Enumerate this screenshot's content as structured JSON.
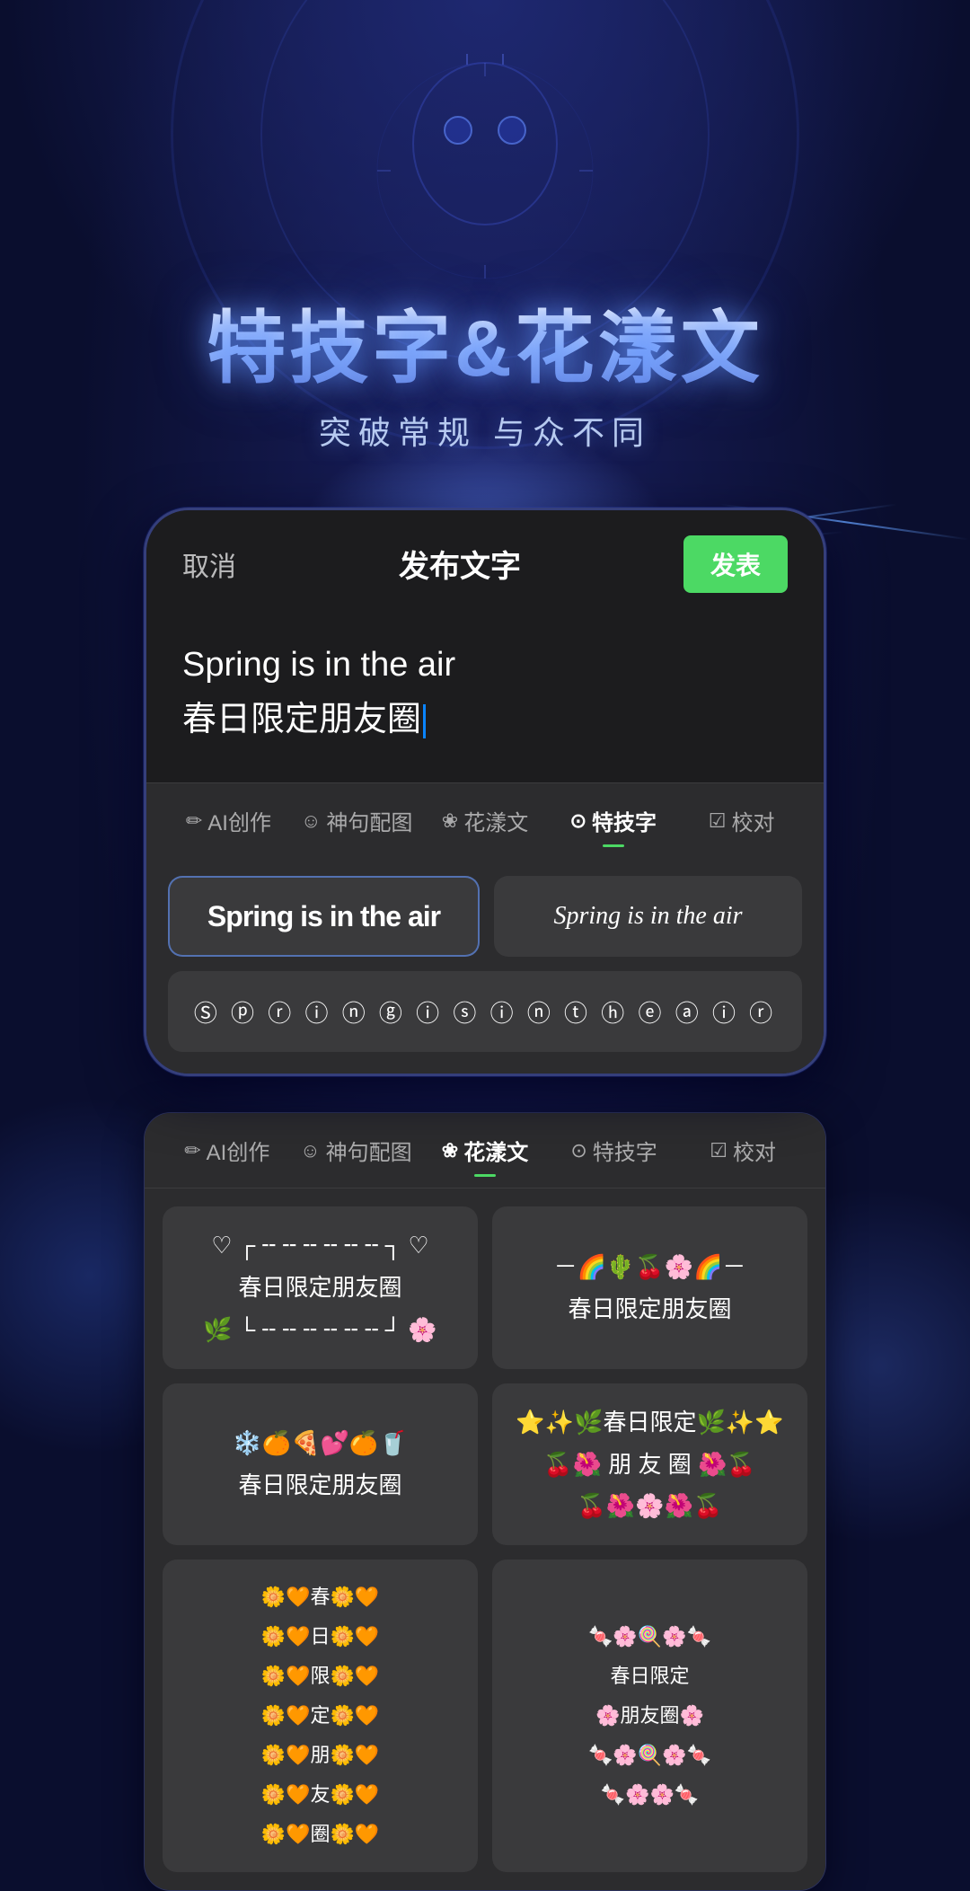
{
  "app": {
    "title": "特技字&花漾文",
    "subtitle": "突破常规 与众不同"
  },
  "editor": {
    "cancel_label": "取消",
    "title": "发布文字",
    "publish_label": "发表",
    "text_line1": "Spring is in the air",
    "text_line2": "春日限定朋友圈"
  },
  "toolbar1": {
    "tabs": [
      {
        "icon": "✏️",
        "label": "AI创作",
        "active": false
      },
      {
        "icon": "😊",
        "label": "神句配图",
        "active": false
      },
      {
        "icon": "✿",
        "label": "花漾文",
        "active": false
      },
      {
        "icon": "⊙",
        "label": "特技字",
        "active": true
      },
      {
        "icon": "☑",
        "label": "校对",
        "active": false
      }
    ]
  },
  "styles": {
    "option1": "Spring is in the air",
    "option2": "Spring is in the air",
    "option3": "Ⓢ ⓟ ⓡ ⓘ ⓝ ⓖ  ⓘ ⓢ  ⓘ ⓝ  ⓣ ⓗ ⓔ  ⓐ ⓘ ⓡ"
  },
  "toolbar2": {
    "tabs": [
      {
        "icon": "✏️",
        "label": "AI创作",
        "active": false
      },
      {
        "icon": "😊",
        "label": "神句配图",
        "active": false
      },
      {
        "icon": "✿",
        "label": "花漾文",
        "active": true
      },
      {
        "icon": "⊙",
        "label": "特技字",
        "active": false
      },
      {
        "icon": "☑",
        "label": "校对",
        "active": false
      }
    ]
  },
  "huawen_cards": [
    {
      "id": "hw1",
      "content": "♡ ┌╌╌╌╌╌╌╌╌╌╌╌┐ ♡\n春日限定朋友圈\n🌿 └╌╌╌╌╌╌╌╌╌╌╌┘ 🌸"
    },
    {
      "id": "hw2",
      "content": "－🌈🌵🌸🌈－\n春日限定朋友圈"
    },
    {
      "id": "hw3",
      "content": "❄️🍊🍕💕🍊🥤\n春日限定朋友圈"
    },
    {
      "id": "hw4",
      "content": "⭐✨🌿春日限定🌿✨⭐\n🍒🌺🌸朋友圈🌸🌺🍒\n🍒🌺🌸🌺🍒"
    },
    {
      "id": "hw5",
      "content": "🌼🧡春🌼🧡\n🌼🧡日🌼🧡\n🌼🧡限🌼🧡\n🌼🧡定🌼🧡\n🌼🧡朋🌼🧡\n🌼🧡友🌼🧡\n🌼🧡圈🌼🧡"
    },
    {
      "id": "hw6",
      "content": "🍬🌸🍭🌸🍬\n春日限定\n🌸朋友圈🌸\n🍬🌸🍭🌸🍬"
    }
  ]
}
